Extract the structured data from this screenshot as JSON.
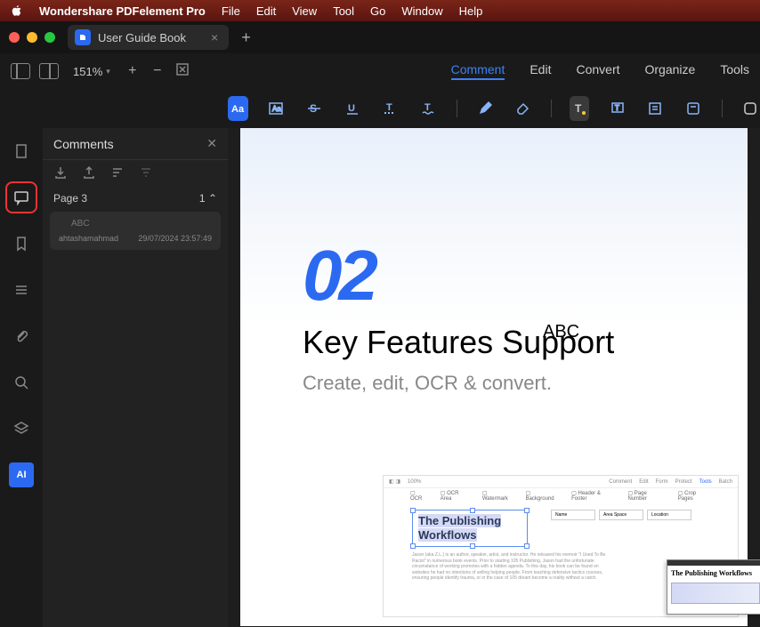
{
  "menubar": {
    "app": "Wondershare PDFelement Pro",
    "items": [
      "File",
      "Edit",
      "View",
      "Tool",
      "Go",
      "Window",
      "Help"
    ]
  },
  "tab": {
    "title": "User Guide Book"
  },
  "zoom": "151%",
  "toptabs": {
    "comment": "Comment",
    "edit": "Edit",
    "convert": "Convert",
    "organize": "Organize",
    "tools": "Tools"
  },
  "panel": {
    "title": "Comments",
    "section": "Page 3",
    "count": "1",
    "card_abc": "ABC",
    "card_user": "ahtashamahmad",
    "card_date": "29/07/2024 23:57:49"
  },
  "doc": {
    "num": "02",
    "abc": "ABC",
    "heading": "Key Features Support",
    "sub": "Create, edit, OCR & convert."
  },
  "mock": {
    "zoom": "100%",
    "menu": [
      "Comment",
      "Edit",
      "Form",
      "Protect",
      "Tools",
      "Batch"
    ],
    "sub": [
      "OCR",
      "OCR Area",
      "Watermark",
      "Background",
      "Header & Footer",
      "Page Number",
      "Crop Pages"
    ],
    "pub1": "The Publishing",
    "pub2": "Workflows",
    "table": [
      "Name",
      "Area Space",
      "Location"
    ],
    "mini_title": "The Publishing Workflows"
  },
  "ai_label": "AI"
}
